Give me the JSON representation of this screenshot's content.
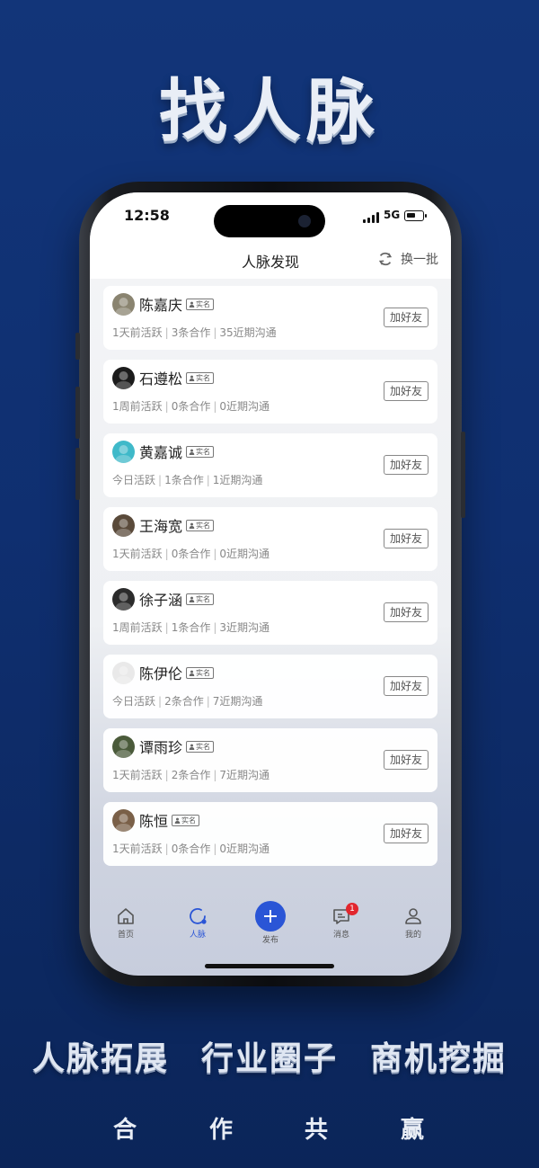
{
  "hero": {
    "title": "找人脉"
  },
  "status": {
    "time": "12:58",
    "network": "5G"
  },
  "nav": {
    "title": "人脉发现",
    "refresh_label": "换一批"
  },
  "badge_label": "实名",
  "add_friend_label": "加好友",
  "contacts": [
    {
      "name": "陈嘉庆",
      "active": "1天前活跃",
      "coop": "3条合作",
      "comm": "35近期沟通",
      "avatar_color": "#8a8470"
    },
    {
      "name": "石遵松",
      "active": "1周前活跃",
      "coop": "0条合作",
      "comm": "0近期沟通",
      "avatar_color": "#1b1b1b"
    },
    {
      "name": "黄嘉诚",
      "active": "今日活跃",
      "coop": "1条合作",
      "comm": "1近期沟通",
      "avatar_color": "#3fb9c9"
    },
    {
      "name": "王海宽",
      "active": "1天前活跃",
      "coop": "0条合作",
      "comm": "0近期沟通",
      "avatar_color": "#5a4a3a"
    },
    {
      "name": "徐子涵",
      "active": "1周前活跃",
      "coop": "1条合作",
      "comm": "3近期沟通",
      "avatar_color": "#2b2b2b"
    },
    {
      "name": "陈伊伦",
      "active": "今日活跃",
      "coop": "2条合作",
      "comm": "7近期沟通",
      "avatar_color": "#e9e9e9"
    },
    {
      "name": "谭雨珍",
      "active": "1天前活跃",
      "coop": "2条合作",
      "comm": "7近期沟通",
      "avatar_color": "#4a5a3a"
    },
    {
      "name": "陈恒",
      "active": "1天前活跃",
      "coop": "0条合作",
      "comm": "0近期沟通",
      "avatar_color": "#7a6048"
    }
  ],
  "tabs": [
    {
      "label": "首页",
      "icon": "home-icon"
    },
    {
      "label": "人脉",
      "icon": "contacts-icon",
      "active": true
    },
    {
      "label": "发布",
      "icon": "plus-icon"
    },
    {
      "label": "消息",
      "icon": "message-icon",
      "badge": "1"
    },
    {
      "label": "我的",
      "icon": "profile-icon"
    }
  ],
  "features": [
    "人脉拓展",
    "行业圈子",
    "商机挖掘"
  ],
  "slogan": [
    "合",
    "作",
    "共",
    "赢"
  ],
  "colors": {
    "accent": "#2a55d6",
    "background": "#123579",
    "badge_red": "#e2262e"
  }
}
